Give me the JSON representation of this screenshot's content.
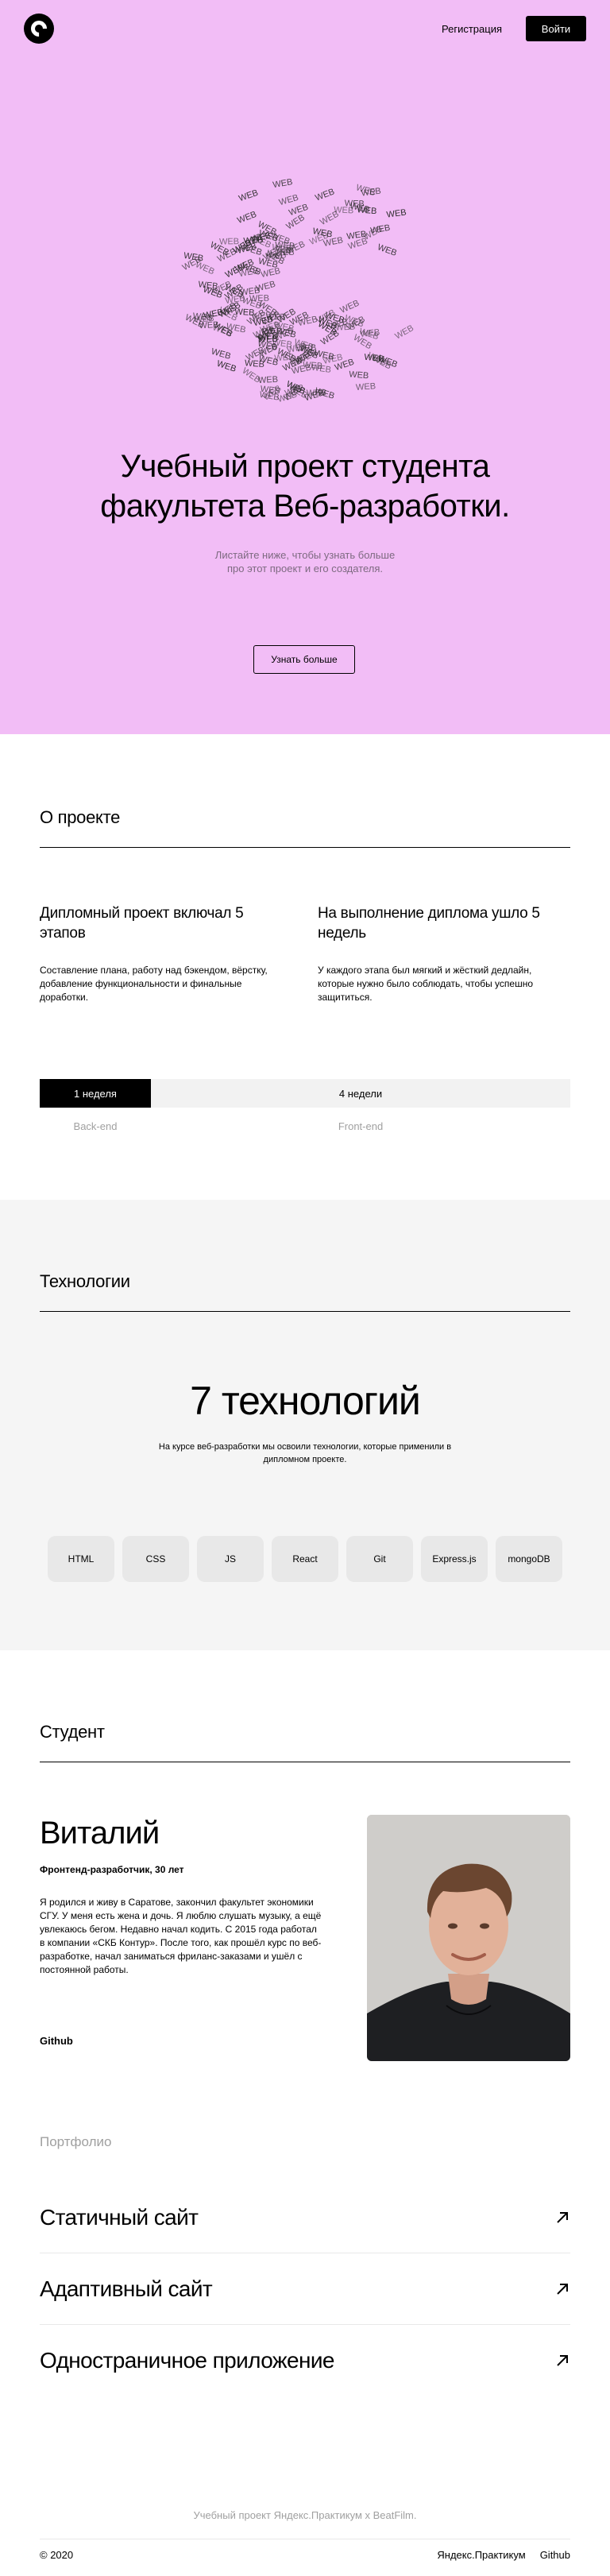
{
  "header": {
    "register_label": "Регистрация",
    "login_label": "Войти"
  },
  "hero": {
    "logo_word": "WEB",
    "title_line1": "Учебный проект студента",
    "title_line2": "факультета Веб-разработки.",
    "subtitle_line1": "Листайте ниже, чтобы узнать больше",
    "subtitle_line2": "про этот проект и его создателя.",
    "more_button": "Узнать больше",
    "background_color": "#f2bdf6"
  },
  "about": {
    "heading": "О проекте",
    "col1": {
      "title": "Дипломный проект включал 5 этапов",
      "text": "Составление плана, работу над бэкендом, вёрстку, добавление функциональности и финальные доработки."
    },
    "col2": {
      "title": "На выполнение диплома ушло 5 недель",
      "text": "У каждого этапа был мягкий и жёсткий дедлайн, которые нужно было соблюдать, чтобы успешно защититься."
    },
    "progress": {
      "back_duration": "1 неделя",
      "front_duration": "4 недели",
      "back_label": "Back-end",
      "front_label": "Front-end"
    }
  },
  "tech": {
    "heading": "Технологии",
    "count": "7 технологий",
    "description": "На курсе веб-разработки мы освоили технологии, которые применили в дипломном проекте.",
    "items": [
      "HTML",
      "CSS",
      "JS",
      "React",
      "Git",
      "Express.js",
      "mongoDB"
    ]
  },
  "student": {
    "heading": "Студент",
    "name": "Виталий",
    "role": "Фронтенд-разработчик, 30 лет",
    "bio": "Я родился и живу в Саратове, закончил факультет экономики СГУ. У меня есть жена и дочь. Я люблю слушать музыку, а ещё увлекаюсь бегом. Недавно начал кодить. С 2015 года работал в компании «СКБ Контур». После того, как прошёл курс по веб-разработке, начал заниматься фриланс-заказами и ушёл с постоянной работы.",
    "github": "Github"
  },
  "portfolio": {
    "title": "Портфолио",
    "items": [
      "Статичный сайт",
      "Адаптивный сайт",
      "Одностраничное приложение"
    ]
  },
  "footer": {
    "note": "Учебный проект Яндекс.Практикум х BeatFilm.",
    "copyright": "© 2020",
    "links": [
      "Яндекс.Практикум",
      "Github"
    ]
  }
}
